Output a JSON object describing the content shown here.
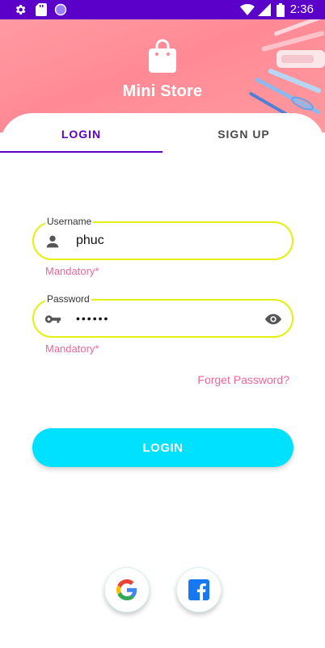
{
  "status_bar": {
    "time": "2:36",
    "left_icons": [
      "gear-icon",
      "sd-card-icon",
      "circle-icon"
    ],
    "right_icons": [
      "wifi-icon",
      "signal-icon",
      "battery-icon"
    ],
    "background": "#5b00c9"
  },
  "header": {
    "app_name": "Mini Store",
    "icon": "shopping-bag-icon",
    "background": "#ff8a95"
  },
  "tabs": [
    {
      "label": "LOGIN",
      "selected": true
    },
    {
      "label": "SIGN UP",
      "selected": false
    }
  ],
  "form": {
    "username": {
      "label": "Username",
      "value": "phuc",
      "helper": "Mandatory*",
      "icon": "person-icon"
    },
    "password": {
      "label": "Password",
      "value": "••••••",
      "helper": "Mandatory*",
      "icon": "key-icon",
      "toggle_icon": "eye-icon"
    },
    "forgot_password": "Forget Password?",
    "login_button": "LOGIN"
  },
  "social": [
    {
      "name": "google",
      "icon": "google-icon"
    },
    {
      "name": "facebook",
      "icon": "facebook-icon"
    }
  ],
  "colors": {
    "primary": "#5b00c9",
    "field_border": "#e4f011",
    "helper_text": "#f0669a",
    "button": "#00e0ff"
  }
}
